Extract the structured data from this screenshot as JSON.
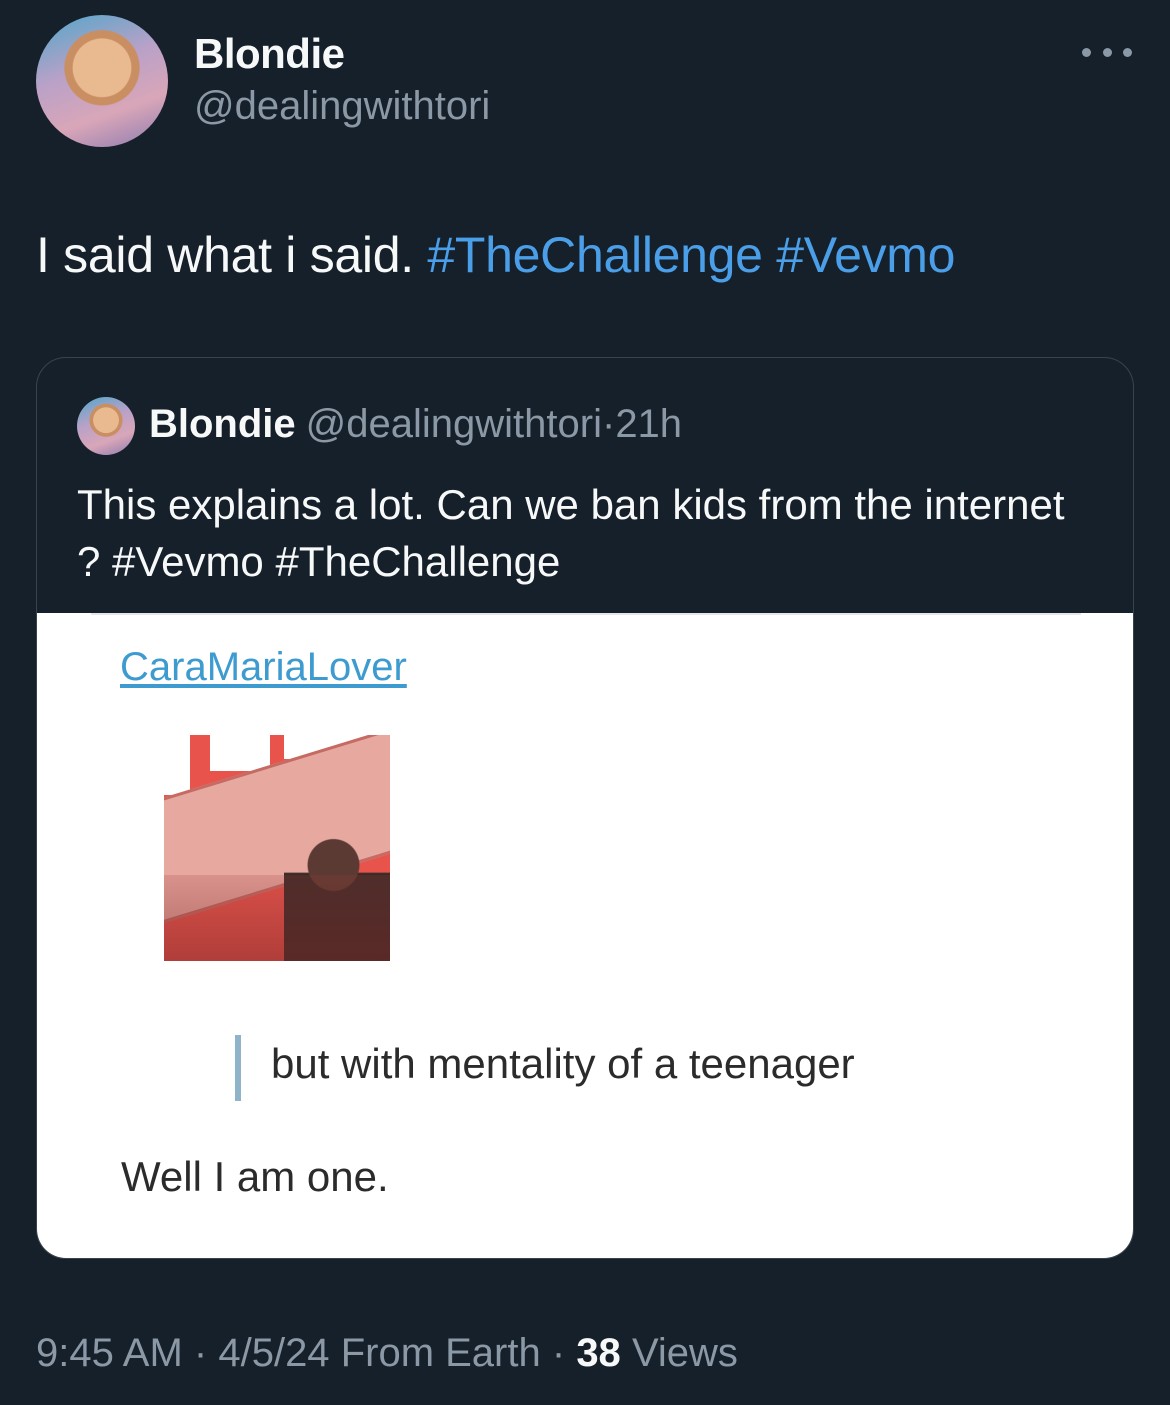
{
  "author": {
    "name": "Blondie",
    "handle": "@dealingwithtori"
  },
  "tweet": {
    "text_plain": "I said what i said.",
    "hashtags": [
      "#TheChallenge",
      "#Vevmo"
    ]
  },
  "quoted_tweet": {
    "name": "Blondie",
    "handle": "@dealingwithtori",
    "separator": "·",
    "age": "21h",
    "text_plain": "This explains a lot. Can we ban kids from the internet ?",
    "hashtags": [
      "#Vevmo",
      "#TheChallenge"
    ],
    "media": {
      "username": "CaraMariaLover",
      "quoted_reply": "but with mentality of a teenager",
      "reply": "Well I am one."
    }
  },
  "footer": {
    "time": "9:45 AM",
    "sep1": "·",
    "date": "4/5/24",
    "source": "From Earth",
    "sep2": "·",
    "views_count": "38",
    "views_label": "Views"
  },
  "colors": {
    "background": "#16202b",
    "hashtag": "#4a9fe8",
    "secondary_text": "#8b98a5",
    "link": "#3d9bd0"
  },
  "icons": {
    "more": "more-horizontal-icon"
  }
}
